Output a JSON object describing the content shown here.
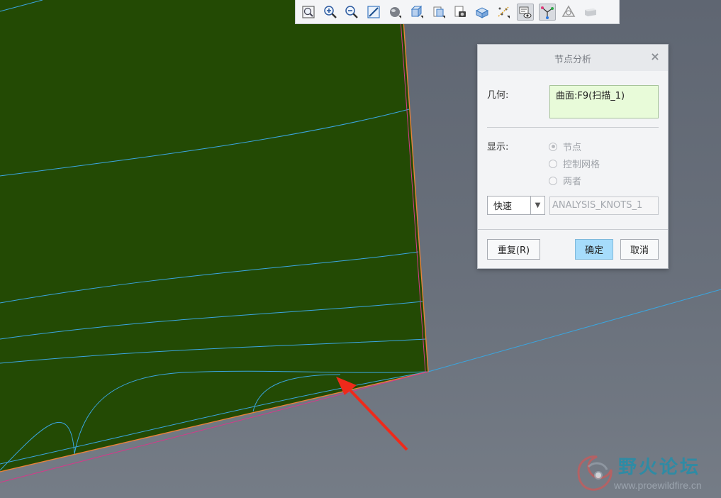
{
  "toolbar": {
    "buttons": [
      {
        "icon": "refit-icon"
      },
      {
        "icon": "zoom-in-icon"
      },
      {
        "icon": "zoom-out-icon"
      },
      {
        "icon": "repaint-icon"
      },
      {
        "icon": "perspective-icon"
      },
      {
        "icon": "display-style-icon"
      },
      {
        "icon": "saved-orientations-icon"
      },
      {
        "icon": "view-manager-icon"
      },
      {
        "icon": "section-icon"
      },
      {
        "icon": "datum-display-icon"
      },
      {
        "icon": "annotation-display-icon"
      },
      {
        "icon": "spin-center-icon"
      },
      {
        "icon": "appearance-icon"
      },
      {
        "icon": "hidden-line-icon"
      }
    ]
  },
  "dialog": {
    "title": "节点分析",
    "geometry_label": "几何:",
    "geometry_value": "曲面:F9(扫描_1)",
    "display_label": "显示:",
    "radio_options": [
      "节点",
      "控制网格",
      "两者"
    ],
    "radio_selected": "节点",
    "mode_select": "快速",
    "analysis_name": "ANALYSIS_KNOTS_1",
    "repeat_button": "重复(R)",
    "ok_button": "确定",
    "cancel_button": "取消"
  },
  "watermark": {
    "title": "野火论坛",
    "url": "www.proewildfire.cn"
  },
  "colors": {
    "surface": "#234a04",
    "background": "#666d78",
    "isoline": "#3aa6e0",
    "edge_orange": "#e8823a",
    "edge_magenta": "#d43a8a",
    "arrow": "#ee2a1b",
    "ok_button": "#a6dcfb",
    "geometry_box": "#e8fbd9"
  }
}
